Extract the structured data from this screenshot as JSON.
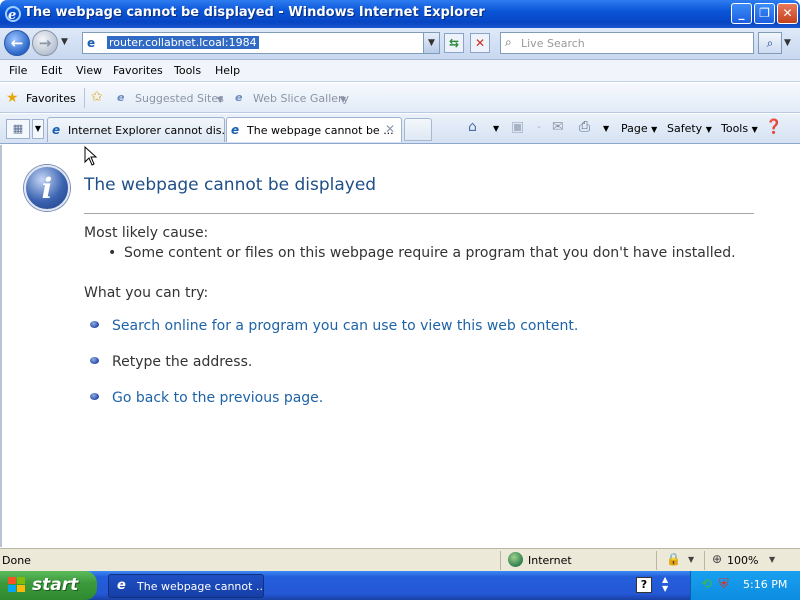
{
  "window": {
    "title": "The webpage cannot be displayed - Windows Internet Explorer",
    "minimize": "_",
    "maximize": "❐",
    "close": "✕"
  },
  "address_bar": {
    "url": "router.collabnet.lcoal:1984",
    "search_placeholder": "Live Search"
  },
  "menu": [
    "File",
    "Edit",
    "View",
    "Favorites",
    "Tools",
    "Help"
  ],
  "favorites_bar": {
    "favorites_label": "Favorites",
    "suggested_sites": "Suggested Sites",
    "web_slice_gallery": "Web Slice Gallery"
  },
  "tabs": [
    {
      "label": "Internet Explorer cannot dis...",
      "active": false
    },
    {
      "label": "The webpage cannot be ...",
      "active": true
    }
  ],
  "command_bar": {
    "page": "Page",
    "safety": "Safety",
    "tools": "Tools"
  },
  "content": {
    "heading": "The webpage cannot be displayed",
    "cause_label": "Most likely cause:",
    "cause_items": [
      "Some content or files on this webpage require a program that you don't have installed."
    ],
    "try_label": "What you can try:",
    "try_items": [
      {
        "text": "Search online for a program you can use to view this web content.",
        "link": true
      },
      {
        "text": "Retype the address.",
        "link": false
      },
      {
        "text": "Go back to the previous page.",
        "link": true
      }
    ]
  },
  "status_bar": {
    "status": "Done",
    "zone": "Internet",
    "zoom": "100%"
  },
  "taskbar": {
    "start_label": "start",
    "task_item": "The webpage cannot ...",
    "clock": "5:16 PM"
  },
  "colors": {
    "heading": "#1f4f88",
    "link": "#1e63a8",
    "titlebar": "#0a55d8",
    "start_button": "#3c9a3c"
  }
}
